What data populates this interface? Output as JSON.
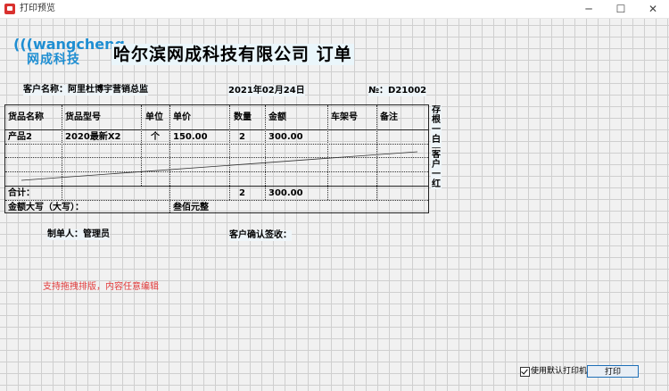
{
  "window": {
    "title": "打印预览",
    "min_glyph": "─",
    "max_glyph": "☐",
    "close_glyph": "✕"
  },
  "logo": {
    "word": "(((wangcheng",
    "cn": "网成科技",
    "color": "#1e8ed2"
  },
  "header": {
    "company": "哈尔滨网成科技有限公司 订单",
    "customer_label": "客户名称：阿里杜博宇营销总监",
    "date": "2021年02月24日",
    "order_no": "№：D21002"
  },
  "table": {
    "columns": [
      "货品名称",
      "货品型号",
      "单位",
      "单价",
      "数量",
      "金额",
      "车架号",
      "备注"
    ],
    "rows": [
      [
        "产品2",
        "2020最新X2",
        "个",
        "150.00",
        "2",
        "300.00",
        "",
        ""
      ]
    ],
    "total_label": "合计：",
    "total_qty": "2",
    "total_amount": "300.00",
    "amount_words_label": "金额大写（大写）：",
    "amount_words": "叁佰元整"
  },
  "side_strips": {
    "strip1": "存根一白一",
    "strip2": "客户一红一"
  },
  "footer": {
    "maker": "制单人：管理员",
    "customer_sign": "客户确认签收：",
    "red_note": "支持拖拽排版，内容任意编辑"
  },
  "controls": {
    "default_printer_label": "使用默认打印机",
    "default_printer_checked": true,
    "print_label": "打印"
  }
}
